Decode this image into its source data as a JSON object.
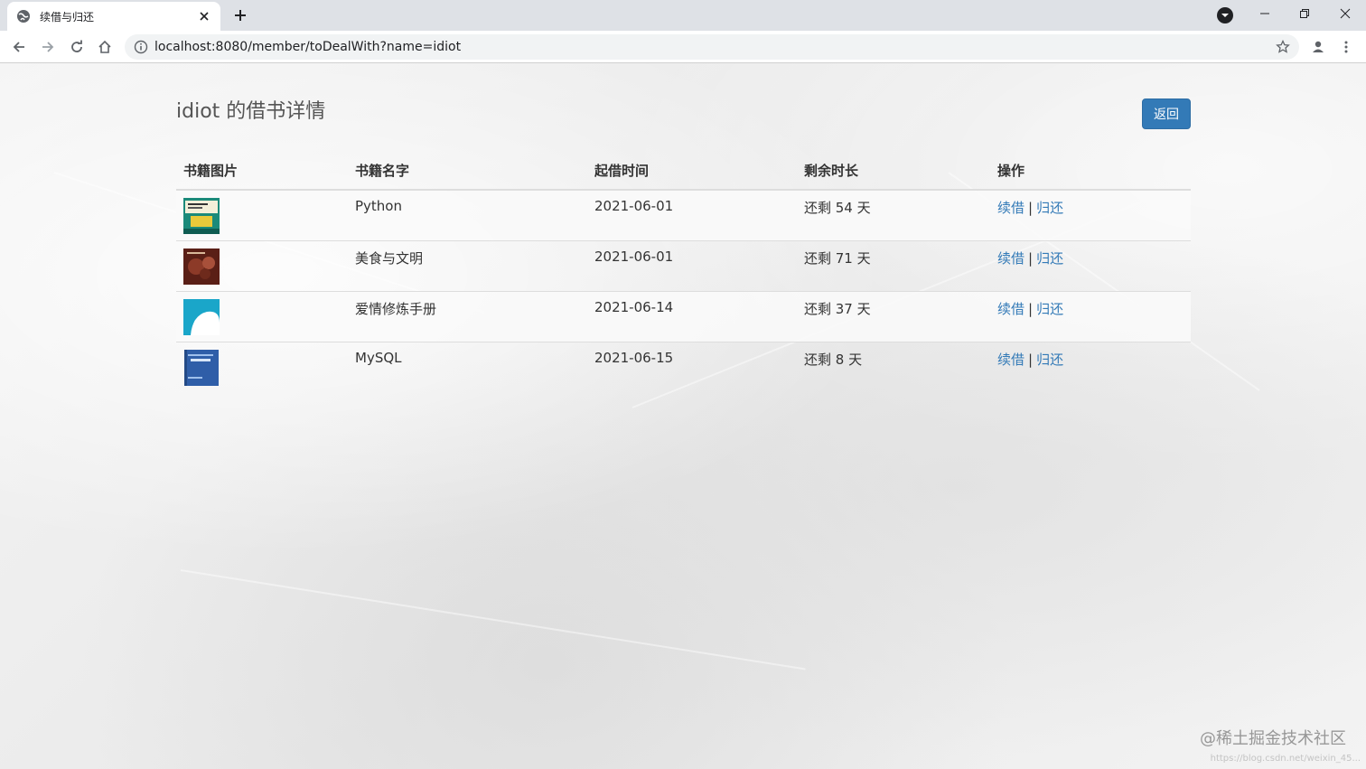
{
  "browser": {
    "tab_title": "续借与归还",
    "url": "localhost:8080/member/toDealWith?name=idiot"
  },
  "page": {
    "title": "idiot 的借书详情",
    "back_label": "返回"
  },
  "table": {
    "headers": [
      "书籍图片",
      "书籍名字",
      "起借时间",
      "剩余时长",
      "操作"
    ],
    "rows": [
      {
        "name": "Python",
        "date": "2021-06-01",
        "remaining": "还剩 54 天",
        "renew": "续借",
        "sep": "|",
        "return": "归还"
      },
      {
        "name": "美食与文明",
        "date": "2021-06-01",
        "remaining": "还剩 71 天",
        "renew": "续借",
        "sep": "|",
        "return": "归还"
      },
      {
        "name": "爱情修炼手册",
        "date": "2021-06-14",
        "remaining": "还剩 37 天",
        "renew": "续借",
        "sep": "|",
        "return": "归还"
      },
      {
        "name": "MySQL",
        "date": "2021-06-15",
        "remaining": "还剩 8 天",
        "renew": "续借",
        "sep": "|",
        "return": "归还"
      }
    ]
  },
  "watermark": {
    "text": "@稀土掘金技术社区",
    "url": "https://blog.csdn.net/weixin_45..."
  },
  "colors": {
    "accent": "#337ab7",
    "chrome_bg": "#dee1e6"
  },
  "icons": {
    "tab": "globe-icon",
    "book_covers": [
      "python-book-cover",
      "food-book-cover",
      "love-book-cover",
      "mysql-book-cover"
    ]
  }
}
